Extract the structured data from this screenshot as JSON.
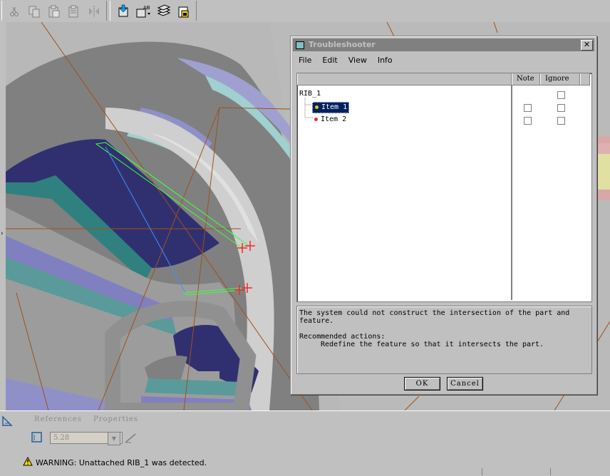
{
  "toolbar": {
    "buttons": [
      "cut-icon",
      "copy-icon",
      "paste-icon",
      "paste-special-icon",
      "mirror-icon",
      "import-icon",
      "rename-icon",
      "layers-icon",
      "save-view-icon"
    ]
  },
  "dialog": {
    "title": "Troubleshooter",
    "close_label": "✕",
    "menu": [
      "File",
      "Edit",
      "View",
      "Info"
    ],
    "columns": {
      "note": "Note",
      "ignore": "Ignore"
    },
    "tree": {
      "root": {
        "label": "RIB_1",
        "note": false,
        "ignore": false,
        "has_note_checkbox": false
      },
      "items": [
        {
          "label": "Item 1",
          "selected": true,
          "marker_color": "#e8c800",
          "note": false,
          "ignore": false
        },
        {
          "label": "Item 2",
          "selected": false,
          "marker_color": "#e03020",
          "note": false,
          "ignore": false
        }
      ]
    },
    "message": {
      "line1": "The system could not construct the intersection of the part and",
      "line2": "feature.",
      "line3": "Recommended actions:",
      "line4": "Redefine the feature so that it intersects the part."
    },
    "ok_label": "OK",
    "cancel_label": "Cancel"
  },
  "dashboard": {
    "tab_references": "References",
    "tab_properties": "Properties",
    "depth_value": "5.28",
    "warning": "WARNING: Unattached RIB_1 was detected."
  },
  "colors": {
    "selection": "#002060",
    "sketch_line": "#40ff40",
    "point": "#ff2030",
    "datum_line": "#a0501a"
  }
}
